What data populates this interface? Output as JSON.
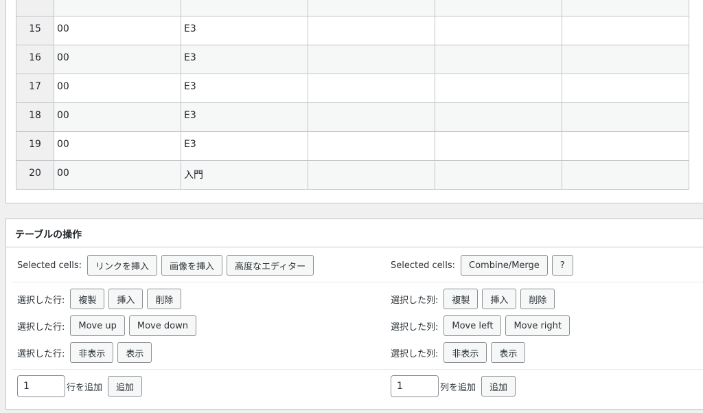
{
  "table_rows": [
    {
      "num": "",
      "a": "",
      "b": "",
      "c": "",
      "d": "",
      "e": ""
    },
    {
      "num": "15",
      "a": "00",
      "b": "E3",
      "c": "",
      "d": "",
      "e": ""
    },
    {
      "num": "16",
      "a": "00",
      "b": "E3",
      "c": "",
      "d": "",
      "e": ""
    },
    {
      "num": "17",
      "a": "00",
      "b": "E3",
      "c": "",
      "d": "",
      "e": ""
    },
    {
      "num": "18",
      "a": "00",
      "b": "E3",
      "c": "",
      "d": "",
      "e": ""
    },
    {
      "num": "19",
      "a": "00",
      "b": "E3",
      "c": "",
      "d": "",
      "e": ""
    },
    {
      "num": "20",
      "a": "00",
      "b": "入門",
      "c": "",
      "d": "",
      "e": ""
    }
  ],
  "ops": {
    "title": "テーブルの操作",
    "selected_cells_label_left": "Selected cells:",
    "insert_link": "リンクを挿入",
    "insert_image": "画像を挿入",
    "advanced_editor": "高度なエディター",
    "selected_cells_label_right": "Selected cells:",
    "combine_merge": "Combine/Merge",
    "help": "?",
    "row_label": "選択した行:",
    "col_label": "選択した列:",
    "duplicate": "複製",
    "insert": "挿入",
    "delete": "削除",
    "move_up": "Move up",
    "move_down": "Move down",
    "move_left": "Move left",
    "move_right": "Move right",
    "hide": "非表示",
    "show": "表示",
    "add_rows_value": "1",
    "add_rows_label": "行を追加",
    "add_cols_value": "1",
    "add_cols_label": "列を追加",
    "add": "追加"
  }
}
